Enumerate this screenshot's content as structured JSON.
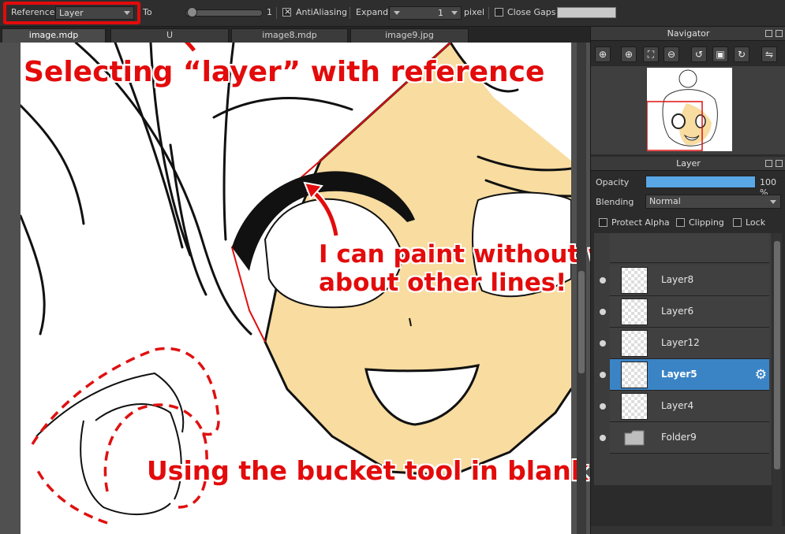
{
  "toolbar": {
    "reference_label": "Reference",
    "reference_value": "Layer",
    "tolerance_label": "To",
    "tolerance_value": "1",
    "antialiasing_label": "AntiAliasing",
    "expand_label": "Expand",
    "expand_value": "1",
    "expand_unit": "pixel",
    "close_gaps_label": "Close Gaps"
  },
  "tabs": [
    "image.mdp",
    "U",
    "image8.mdp",
    "image9.jpg"
  ],
  "annotations": {
    "top": "Selecting “layer” with reference",
    "middle_line1": "I can paint without worrying",
    "middle_line2": "about other lines!",
    "bottom": "Using the bucket tool in blank areas"
  },
  "navigator": {
    "title": "Navigator",
    "buttons": [
      "zoom-fit-icon",
      "zoom-in-icon",
      "fit-window-icon",
      "zoom-out-icon",
      "rotate-left-icon",
      "actual-size-icon",
      "rotate-right-icon",
      "flip-horizontal-icon"
    ]
  },
  "layer_panel": {
    "title": "Layer",
    "opacity_label": "Opacity",
    "opacity_value": "100 %",
    "opacity_fraction": 1.0,
    "blending_label": "Blending",
    "blending_value": "Normal",
    "protect_alpha_label": "Protect Alpha",
    "clipping_label": "Clipping",
    "lock_label": "Lock",
    "layers": [
      {
        "name": "Layer8",
        "selected": false
      },
      {
        "name": "Layer6",
        "selected": false
      },
      {
        "name": "Layer12",
        "selected": false
      },
      {
        "name": "Layer5",
        "selected": true
      },
      {
        "name": "Layer4",
        "selected": false
      },
      {
        "name": "Folder9",
        "selected": false
      }
    ]
  },
  "colors": {
    "annotation_red": "#e30b0b",
    "skin": "#f8dca0",
    "selection_blue": "#3a84c6"
  }
}
